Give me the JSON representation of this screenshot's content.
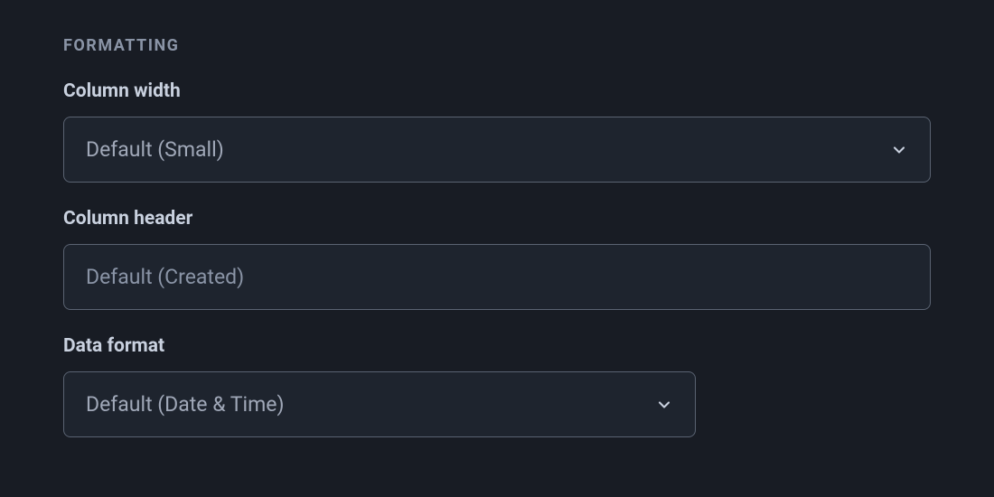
{
  "section": {
    "title": "FORMATTING"
  },
  "fields": {
    "column_width": {
      "label": "Column width",
      "value": "Default (Small)"
    },
    "column_header": {
      "label": "Column header",
      "placeholder": "Default (Created)"
    },
    "data_format": {
      "label": "Data format",
      "value": "Default (Date & Time)"
    }
  }
}
